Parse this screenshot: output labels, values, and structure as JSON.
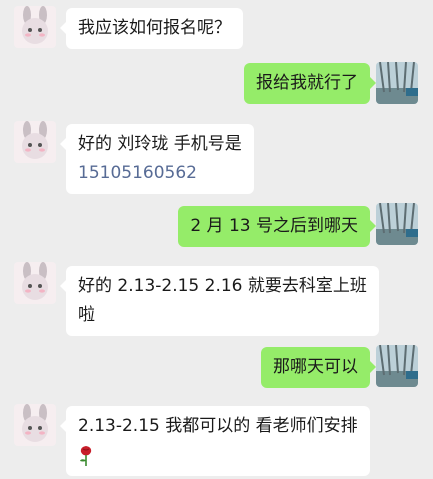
{
  "messages": [
    {
      "side": "in",
      "lines": [
        "我应该如何报名呢？"
      ]
    },
    {
      "side": "out",
      "lines": [
        "报给我就行了"
      ]
    },
    {
      "side": "in",
      "lines": [
        "好的 刘玲珑 手机号是"
      ],
      "phone": "15105160562"
    },
    {
      "side": "out",
      "lines": [
        "2 月 13 号之后到哪天"
      ]
    },
    {
      "side": "in",
      "lines": [
        "好的 2.13-2.15 2.16 就要去科室上班",
        "啦"
      ]
    },
    {
      "side": "out",
      "lines": [
        "那哪天可以"
      ]
    },
    {
      "side": "in",
      "lines": [
        "2.13-2.15 我都可以的 看老师们安排"
      ],
      "emoji": "rose-emoji"
    }
  ],
  "colors": {
    "background": "#ededed",
    "incoming_bubble": "#ffffff",
    "outgoing_bubble": "#95ec69",
    "link": "#576b95"
  }
}
